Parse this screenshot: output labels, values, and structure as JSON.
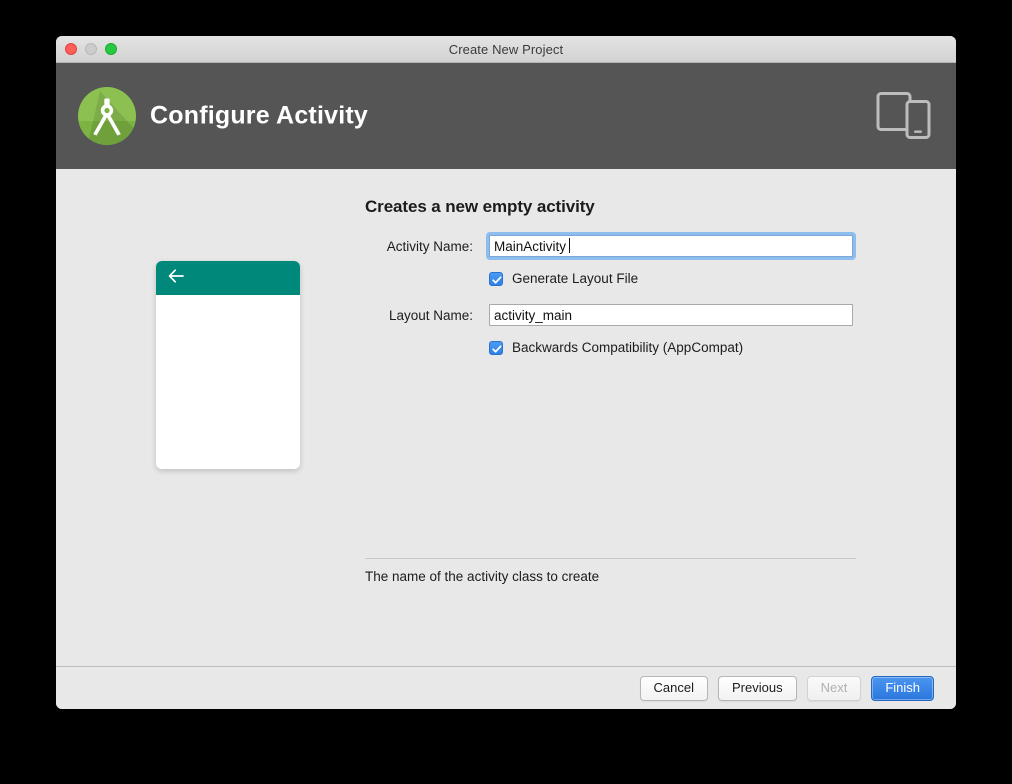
{
  "window": {
    "title": "Create New Project",
    "controls": [
      {
        "name": "close",
        "color": "#ff5f57"
      },
      {
        "name": "minimize",
        "color": "#cccccc"
      },
      {
        "name": "maximize",
        "color": "#28c840"
      }
    ]
  },
  "header": {
    "title": "Configure Activity",
    "background": "#555555",
    "logo_icon": "android-studio-logo",
    "device_icon": "tablet-and-phone-icon"
  },
  "preview": {
    "appbar_color": "#00897b",
    "back_icon": "back-arrow-icon"
  },
  "form": {
    "heading": "Creates a new empty activity",
    "activity_name": {
      "label": "Activity Name:",
      "value": "MainActivity",
      "focused": true
    },
    "generate_layout": {
      "label": "Generate Layout File",
      "checked": true
    },
    "layout_name": {
      "label": "Layout Name:",
      "value": "activity_main",
      "focused": false
    },
    "backwards_compat": {
      "label": "Backwards Compatibility (AppCompat)",
      "checked": true
    }
  },
  "hint": {
    "text": "The name of the activity class to create"
  },
  "footer": {
    "cancel_label": "Cancel",
    "previous_label": "Previous",
    "next_label": "Next",
    "finish_label": "Finish",
    "primary_color": "#2a77dd"
  }
}
